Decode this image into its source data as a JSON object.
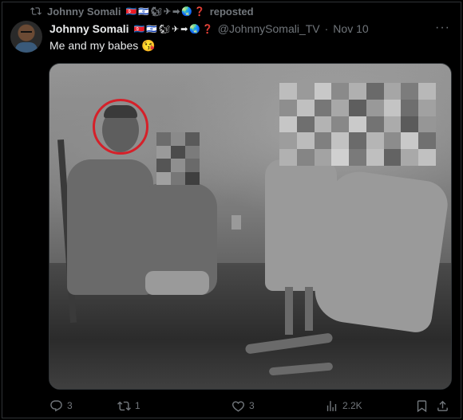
{
  "repost": {
    "author": "Johnny Somali",
    "label": "reposted"
  },
  "tweet": {
    "display_name": "Johnny Somali",
    "handle": "@JohnnySomali_TV",
    "separator": "·",
    "date": "Nov 10",
    "text": "Me and my babes 😘",
    "more_label": "···"
  },
  "name_emojis": [
    "🇰🇵",
    "🇮🇱",
    "🐿",
    "✈",
    "➡",
    "🌏",
    "❓"
  ],
  "actions": {
    "reply_count": "3",
    "repost_count": "1",
    "like_count": "3",
    "view_count": "2.2K"
  },
  "colors": {
    "background": "#000000",
    "text": "#e7e9ea",
    "muted": "#71767b",
    "highlight_circle": "#d52029"
  }
}
